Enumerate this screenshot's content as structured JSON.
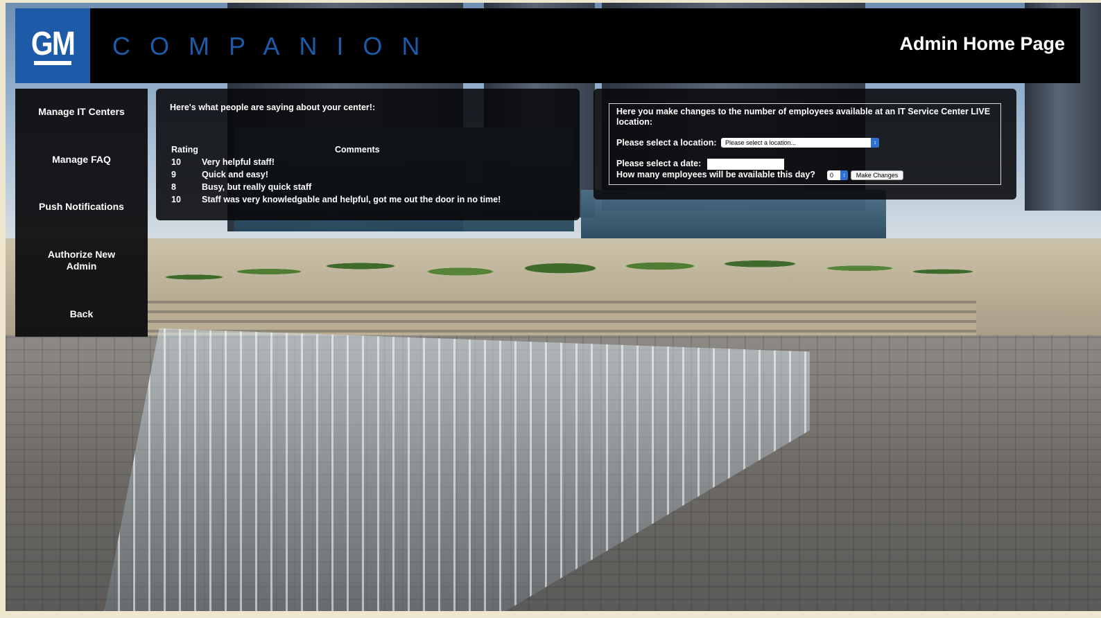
{
  "header": {
    "logo_text": "GM",
    "brand": "COMPANION",
    "page_title": "Admin Home Page"
  },
  "sidebar": {
    "items": [
      {
        "label": "Manage IT Centers"
      },
      {
        "label": "Manage FAQ"
      },
      {
        "label": "Push Notifications"
      },
      {
        "label": "Authorize New Admin"
      },
      {
        "label": "Back"
      }
    ]
  },
  "comments": {
    "heading": "Here's what people are saying about your center!:",
    "columns": {
      "rating": "Rating",
      "comments": "Comments"
    },
    "rows": [
      {
        "rating": "10",
        "comment": "Very helpful staff!"
      },
      {
        "rating": "9",
        "comment": "Quick and easy!"
      },
      {
        "rating": "8",
        "comment": "Busy, but really quick staff"
      },
      {
        "rating": "10",
        "comment": "Staff was very knowledgable and helpful, got me out the door in no time!"
      }
    ]
  },
  "staffing": {
    "intro": "Here you make changes to the number of employees available at an IT Service Center LIVE location:",
    "location_label": "Please select a location:",
    "location_value": "Please select a location...",
    "date_label": "Please select a date:",
    "date_value": "",
    "employees_label": "How many employees will be available this day?",
    "employees_value": "0",
    "submit_label": "Make Changes"
  },
  "colors": {
    "brand_blue": "#1d5aa8",
    "panel_bg": "#08080a",
    "header_bg": "#000000"
  }
}
